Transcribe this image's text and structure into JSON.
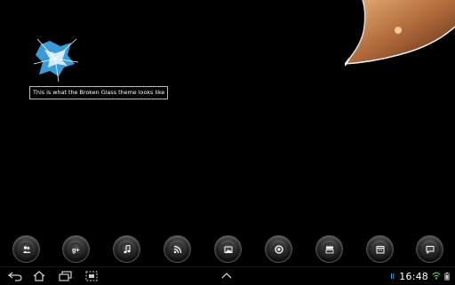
{
  "tooltip": {
    "text": "This is what the Broken Glass theme looks like"
  },
  "dock": {
    "apps": [
      {
        "icon": "people-icon"
      },
      {
        "icon": "google-plus-icon"
      },
      {
        "icon": "music-note-icon"
      },
      {
        "icon": "rss-icon"
      },
      {
        "icon": "photo-gallery-icon"
      },
      {
        "icon": "chrome-icon"
      },
      {
        "icon": "youtube-icon"
      },
      {
        "icon": "calendar-icon"
      },
      {
        "icon": "message-icon"
      }
    ]
  },
  "status": {
    "time": "16:48"
  },
  "colors": {
    "background": "#000000",
    "glass_blue": "#4aa6e0",
    "status_green": "#5fd36b"
  }
}
